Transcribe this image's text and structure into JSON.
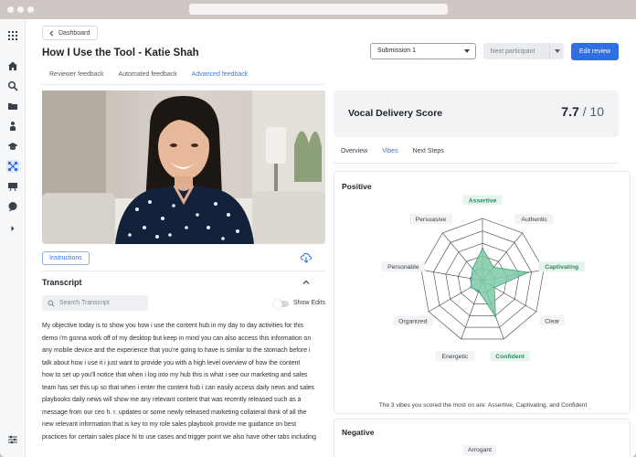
{
  "header": {
    "back_label": "Dashboard",
    "title": "How I Use the Tool - Katie Shah",
    "tabs": [
      {
        "label": "Reviewer feedback",
        "active": false
      },
      {
        "label": "Automated feedback",
        "active": false
      },
      {
        "label": "Advanced feedback",
        "active": true
      }
    ],
    "submission_select": "Submission 1",
    "next_label": "Next participant",
    "edit_label": "Edit review",
    "accent_color": "#2f6fe2"
  },
  "rail": {
    "icons": [
      "apps-grid-icon",
      "home-icon",
      "search-icon",
      "folder-icon",
      "person-icon",
      "graduation-cap-icon",
      "nodes-icon",
      "presentation-icon",
      "chat-icon",
      "chevron-right-icon",
      "sliders-icon"
    ],
    "active_index": 6
  },
  "video": {
    "instructions_label": "Instructions"
  },
  "transcript": {
    "title": "Transcript",
    "search_placeholder": "Search Transcript",
    "toggle_label": "Show Edits",
    "toggle_on": false,
    "lines": [
      "My objective today is to show you how i use the content hub in my day to day activities for this",
      "demo i'm gonna work off of my desktop but keep in mind you can also access this information on",
      "any mobile device and the experience that you're going to have is similar to the stomach before i",
      "talk about how i use it i just want to provide you with a high level overview of how the content",
      "how to set up you'll notice that when i log into my hub this is what i see our marketing and sales",
      "team has set this up so that when i enter the content hub i can easily access daily news and sales",
      "playbooks daily news will show me any relevant content that was recently released such as a",
      "message from our ceo h. r. updates or some newly released marketing collateral think of all the",
      "new relevant information that is key to my role sales playbook provide me guidance on best",
      "practices for certain sales place hi to use cases and trigger point we also have other tabs including"
    ]
  },
  "score": {
    "label": "Vocal Delivery Score",
    "value": "7.7",
    "max": "/ 10"
  },
  "detail_tabs": [
    {
      "label": "Overview",
      "active": false
    },
    {
      "label": "Vibes",
      "active": true
    },
    {
      "label": "Next Steps",
      "active": false
    }
  ],
  "positive": {
    "heading": "Positive",
    "summary": "The 3 vibes you scored the most on are: Assertive, Captivating, and Confident",
    "fill_color": "#7ccaa6"
  },
  "negative": {
    "heading": "Negative",
    "visible_labels": [
      "Arrogant"
    ]
  },
  "chart_data": {
    "type": "radar",
    "axes": [
      "Assertive",
      "Authentic",
      "Captivating",
      "Clear",
      "Confident",
      "Energetic",
      "Organized",
      "Personable",
      "Persuasive"
    ],
    "highlighted": [
      "Assertive",
      "Captivating",
      "Confident"
    ],
    "values": [
      0.52,
      0.28,
      0.75,
      0.22,
      0.62,
      0.18,
      0.22,
      0.18,
      0.25
    ],
    "range": [
      0,
      1
    ],
    "grid_levels": 5
  }
}
